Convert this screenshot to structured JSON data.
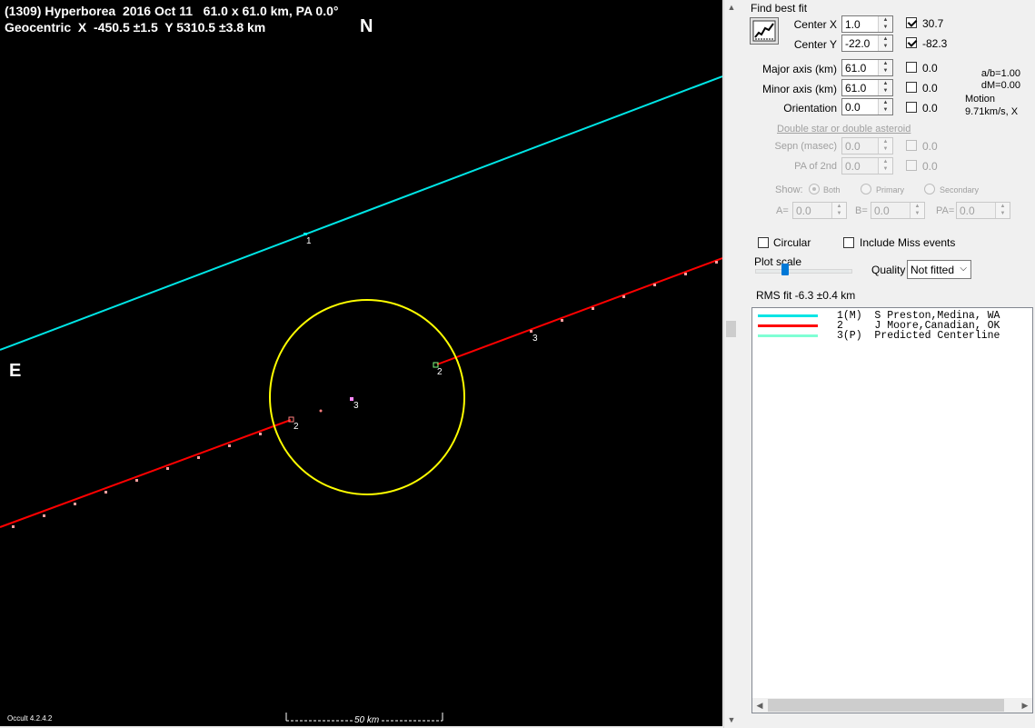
{
  "plot": {
    "title_line1": "(1309) Hyperborea  2016 Oct 11   61.0 x 61.0 km, PA 0.0°",
    "title_line2": "Geocentric  X  -450.5 ±1.5  Y 5310.5 ±3.8 km",
    "north_label": "N",
    "east_label": "E",
    "chord_labels": {
      "c1": "1",
      "c2a": "2",
      "c2b": "2",
      "c3a": "3",
      "c3b": "3"
    },
    "scale_label": "50 km",
    "version": "Occult 4.2.4.2",
    "colors": {
      "background": "#000000",
      "chord1": "#00e5e5",
      "chord2": "#ff0000",
      "outline": "#ffff00",
      "ticks": "#ff7f7f"
    }
  },
  "panel": {
    "find_best_fit": "Find best fit",
    "center_x": {
      "label": "Center X",
      "value": "1.0",
      "check_value": "30.7",
      "checked": true
    },
    "center_y": {
      "label": "Center Y",
      "value": "-22.0",
      "check_value": "-82.3",
      "checked": true
    },
    "major_axis": {
      "label": "Major axis (km)",
      "value": "61.0",
      "check_value": "0.0"
    },
    "minor_axis": {
      "label": "Minor axis (km)",
      "value": "61.0",
      "check_value": "0.0"
    },
    "orientation": {
      "label": "Orientation",
      "value": "0.0",
      "check_value": "0.0"
    },
    "ratio_ab": "a/b=1.00",
    "dm": "dM=0.00",
    "motion_label": "Motion",
    "motion_value": "9.71km/s, X",
    "double_header": "Double star  or  double asteroid",
    "sepn": {
      "label": "Sepn (masec)",
      "value": "0.0",
      "check_value": "0.0"
    },
    "pa2": {
      "label": "PA of 2nd",
      "value": "0.0",
      "check_value": "0.0"
    },
    "show_label": "Show:",
    "show_opts": {
      "both": "Both",
      "primary": "Primary",
      "secondary": "Secondary"
    },
    "a_label": "A=",
    "a_value": "0.0",
    "b_label": "B=",
    "b_value": "0.0",
    "pa_label": "PA=",
    "pa_value": "0.0",
    "circular": "Circular",
    "include_miss": "Include Miss events",
    "plot_scale": "Plot scale",
    "quality_label": "Quality",
    "quality_value": "Not fitted",
    "rms_fit": "RMS fit -6.3 ±0.4 km",
    "legend": [
      {
        "text": "1(M)  S Preston,Medina, WA",
        "color": "#00e5e5"
      },
      {
        "text": "2     J Moore,Canadian, OK",
        "color": "#ff0000"
      },
      {
        "text": "3(P)  Predicted Centerline",
        "color": "#7fffd4"
      }
    ]
  }
}
